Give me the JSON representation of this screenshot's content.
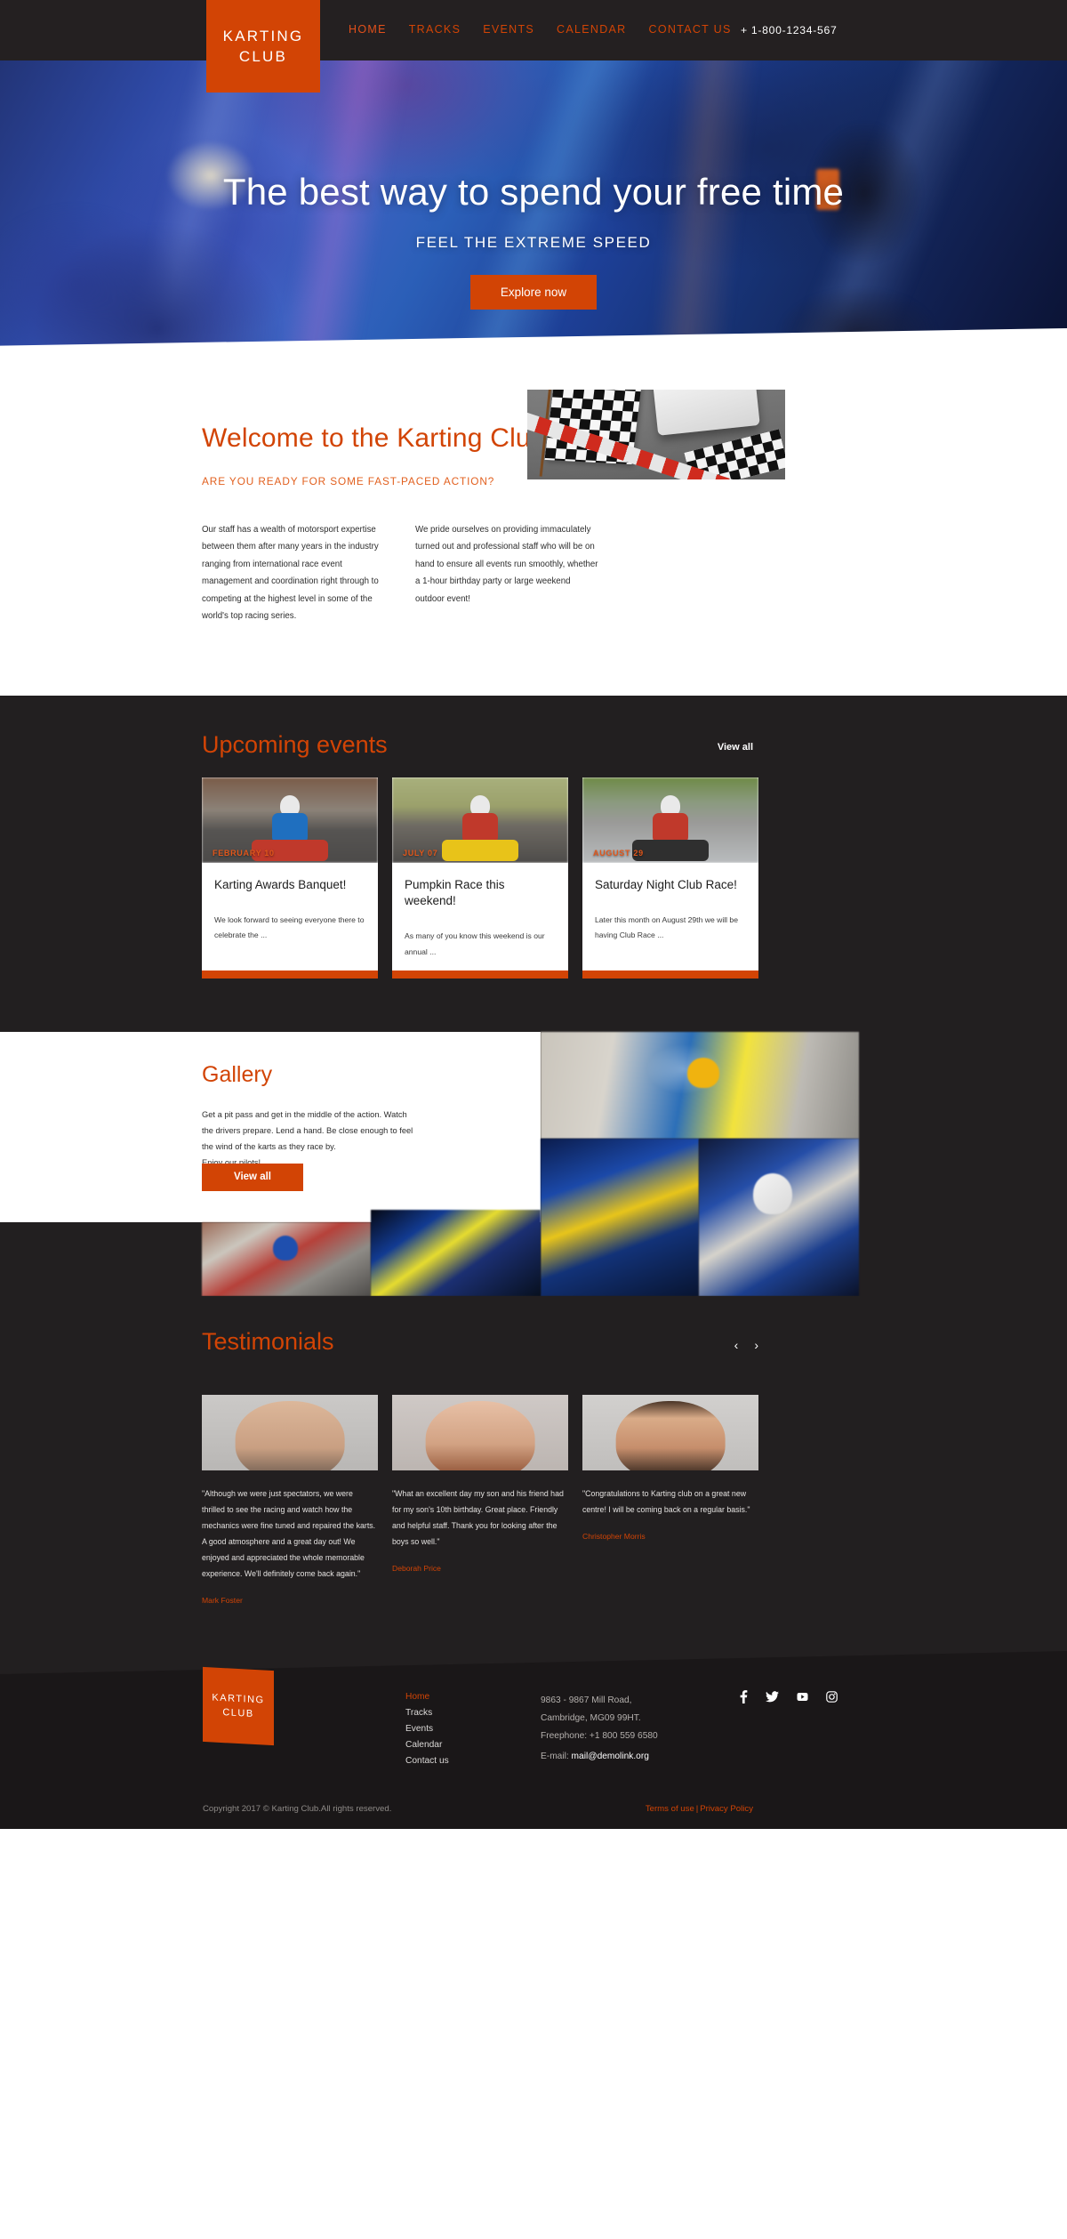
{
  "brand": {
    "line1": "KARTING",
    "line2": "CLUB"
  },
  "header": {
    "nav": [
      {
        "label": "HOME",
        "active": true
      },
      {
        "label": "TRACKS",
        "active": false
      },
      {
        "label": "EVENTS",
        "active": false
      },
      {
        "label": "CALENDAR",
        "active": false
      },
      {
        "label": "CONTACT US",
        "active": false
      }
    ],
    "phone": "+ 1-800-1234-567"
  },
  "hero": {
    "title": "The best way to spend your free time",
    "subtitle": "FEEL THE EXTREME SPEED",
    "cta": "Explore now"
  },
  "welcome": {
    "title": "Welcome to the Karting Club",
    "kicker": "ARE YOU READY FOR SOME FAST-PACED ACTION?",
    "col1": "Our staff has a wealth of motorsport expertise between them after many years in the industry ranging from international race event management and coordination right through to competing at the highest level in some of the world's top racing series.",
    "col2": "We pride ourselves on providing immaculately turned out and professional staff who will be on hand to ensure all events run smoothly, whether a 1-hour birthday party or large weekend outdoor event!"
  },
  "events": {
    "title": "Upcoming events",
    "view_all": "View all",
    "cards": [
      {
        "date": "FEBRUARY 10",
        "title": "Karting Awards Banquet!",
        "text": "We look forward to seeing everyone there to celebrate the ..."
      },
      {
        "date": "JULY 07",
        "title": "Pumpkin Race this weekend!",
        "text": "As many of you know this weekend is our annual ..."
      },
      {
        "date": "AUGUST 29",
        "title": "Saturday Night Club Race!",
        "text": "Later this month on August 29th we will be having Club Race ..."
      }
    ]
  },
  "gallery": {
    "title": "Gallery",
    "text": "Get a pit pass and get in the middle of the action. Watch the drivers prepare. Lend a hand. Be close enough to feel the wind of the karts as they race by.\nEnjoy our pilots!",
    "button": "View all"
  },
  "testimonials": {
    "title": "Testimonials",
    "prev": "‹",
    "next": "›",
    "items": [
      {
        "quote": "\"Although we were just spectators, we were thrilled to see the racing and watch how the mechanics were fine tuned and repaired the karts. A good atmosphere and a great day out! We enjoyed and appreciated the whole memorable experience. We'll definitely come back again.\"",
        "author": "Mark Foster"
      },
      {
        "quote": "\"What an excellent day my son and his friend had for my son's 10th birthday. Great place. Friendly and helpful staff. Thank you for looking after the boys so well.\"",
        "author": "Deborah Price"
      },
      {
        "quote": "\"Congratulations to Karting club on a great new centre! I will be coming back on a regular basis.\"",
        "author": "Christopher Morris"
      }
    ]
  },
  "footer": {
    "nav": [
      {
        "label": "Home",
        "active": true
      },
      {
        "label": "Tracks",
        "active": false
      },
      {
        "label": "Events",
        "active": false
      },
      {
        "label": "Calendar",
        "active": false
      },
      {
        "label": "Contact us",
        "active": false
      }
    ],
    "address_line1": "9863 - 9867 Mill Road,",
    "address_line2": "Cambridge, MG09 99HT.",
    "address_line3": "Freephone: +1 800 559 6580",
    "email_label": "E-mail:",
    "email_value": "mail@demolink.org",
    "socials": [
      "facebook-icon",
      "twitter-icon",
      "youtube-icon",
      "instagram-icon"
    ],
    "copyright": "Copyright 2017 ©  Karting Club.All rights reserved.",
    "terms": "Terms of use",
    "privacy": "Privacy Policy"
  },
  "colors": {
    "accent": "#d24405",
    "dark": "#221f20",
    "footer_dark": "#1a1718"
  }
}
